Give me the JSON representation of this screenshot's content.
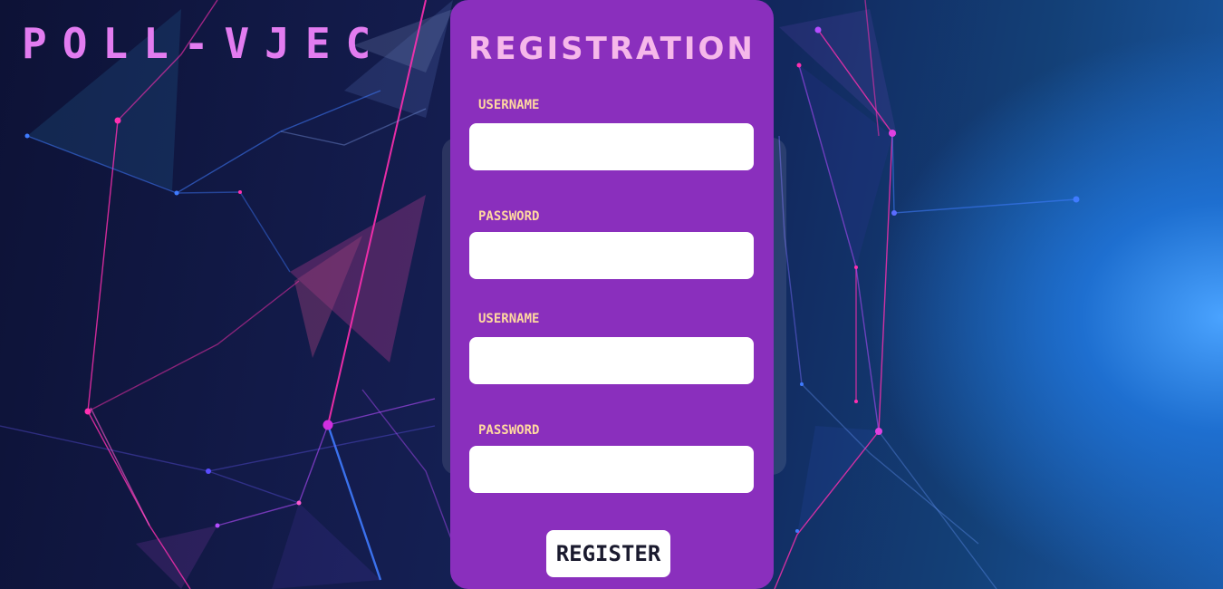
{
  "brand": {
    "title": "POLL-VJEC"
  },
  "form": {
    "title": "REGISTRATION",
    "fields": [
      {
        "label": "USERNAME",
        "value": "",
        "placeholder": ""
      },
      {
        "label": "PASSWORD",
        "value": "",
        "placeholder": ""
      },
      {
        "label": "USERNAME",
        "value": "",
        "placeholder": ""
      },
      {
        "label": "PASSWORD",
        "value": "",
        "placeholder": ""
      }
    ],
    "submit_label": "REGISTER"
  },
  "colors": {
    "brand_text": "#e27cf0",
    "card_background": "#8a2fbd",
    "card_title": "#f6b8ea",
    "field_label": "#ffd8a0",
    "network_pink": "#ff2fb0",
    "network_blue": "#3f7bff",
    "network_violet": "#b44cff"
  },
  "background": {
    "illustration": "polygon-network"
  }
}
